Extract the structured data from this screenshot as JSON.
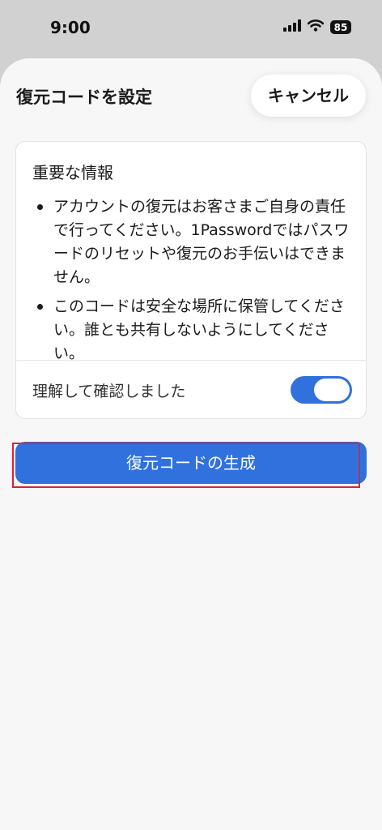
{
  "status_bar": {
    "time": "9:00",
    "battery": "85",
    "icons": [
      "signal-icon",
      "wifi-icon",
      "battery-icon"
    ]
  },
  "sheet": {
    "title": "復元コードを設定",
    "cancel_label": "キャンセル"
  },
  "info_card": {
    "heading": "重要な情報",
    "bullets": [
      "アカウントの復元はお客さまご自身の責任で行ってください。1Passwordではパスワードのリセットや復元のお手伝いはできません。",
      "このコードは安全な場所に保管してください。誰とも共有しないようにしてください。"
    ],
    "confirm_label": "理解して確認しました",
    "confirm_toggle_on": true
  },
  "generate_button_label": "復元コードの生成",
  "colors": {
    "accent": "#3071de",
    "highlight": "#d9233a",
    "sheet_background": "#f7f7f7",
    "status_background": "#d1d1d1"
  }
}
